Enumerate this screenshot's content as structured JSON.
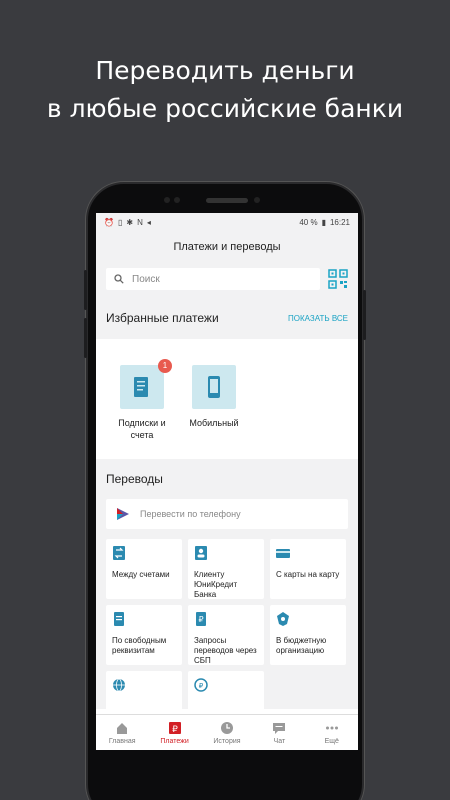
{
  "headline": {
    "line1": "Переводить деньги",
    "line2": "в любые российские банки"
  },
  "status": {
    "left_icons": [
      "alarm-icon",
      "sim-icon",
      "bluetooth-icon",
      "nfc-icon",
      "location-icon"
    ],
    "battery": "40 %",
    "time": "16:21"
  },
  "header": {
    "title": "Платежи и переводы"
  },
  "search": {
    "placeholder": "Поиск"
  },
  "favorites": {
    "title": "Избранные платежи",
    "show_all": "ПОКАЗАТЬ ВСЕ",
    "items": [
      {
        "label": "Подписки и счета",
        "badge": "1",
        "icon": "document-icon"
      },
      {
        "label": "Мобильный",
        "icon": "phone-icon"
      }
    ]
  },
  "transfers": {
    "title": "Переводы",
    "phone_transfer": "Перевести по телефону",
    "tiles": [
      {
        "label": "Между счетами",
        "icon": "swap-icon"
      },
      {
        "label": "Клиенту ЮниКредит Банка",
        "icon": "person-icon"
      },
      {
        "label": "С карты на карту",
        "icon": "card-icon"
      },
      {
        "label": "По свободным реквизитам",
        "icon": "form-icon"
      },
      {
        "label": "Запросы переводов через СБП",
        "icon": "request-icon"
      },
      {
        "label": "В бюджетную организацию",
        "icon": "emblem-icon"
      },
      {
        "label": "",
        "icon": "globe-icon"
      },
      {
        "label": "",
        "icon": "currency-exchange-icon"
      }
    ]
  },
  "tabs": [
    {
      "label": "Главная",
      "icon": "home-icon",
      "active": false
    },
    {
      "label": "Платежи",
      "icon": "ruble-icon",
      "active": true
    },
    {
      "label": "История",
      "icon": "clock-icon",
      "active": false
    },
    {
      "label": "Чат",
      "icon": "chat-icon",
      "active": false
    },
    {
      "label": "Ещё",
      "icon": "more-icon",
      "active": false
    }
  ],
  "colors": {
    "accent": "#1aa3c4",
    "active_tab": "#d21f25",
    "badge": "#e85a4f",
    "tile_icon": "#2b8ab0",
    "background": "#3a3b3f"
  }
}
